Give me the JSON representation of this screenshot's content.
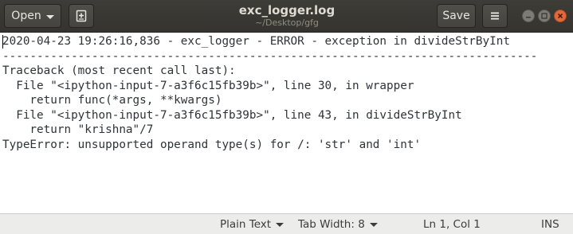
{
  "window": {
    "title": "exc_logger.log",
    "subtitle": "~/Desktop/gfg"
  },
  "toolbar": {
    "open_label": "Open",
    "save_label": "Save"
  },
  "icons": {
    "new_tab": "new-tab-icon",
    "menu": "hamburger-menu-icon",
    "minimize": "minimize-icon",
    "maximize": "maximize-icon",
    "close": "close-icon"
  },
  "colors": {
    "headerbar": "#3d3c37",
    "close_button": "#e5683a",
    "text": "#2e3436",
    "statusbar": "#ececea"
  },
  "editor": {
    "lines": [
      "2020-04-23 19:26:16,836 - exc_logger - ERROR - exception in divideStrByInt",
      "------------------------------------------------------------------------------",
      "Traceback (most recent call last):",
      "  File \"<ipython-input-7-a3f6c15fb39b>\", line 30, in wrapper",
      "    return func(*args, **kwargs)",
      "  File \"<ipython-input-7-a3f6c15fb39b>\", line 43, in divideStrByInt",
      "    return \"krishna\"/7",
      "TypeError: unsupported operand type(s) for /: 'str' and 'int'"
    ]
  },
  "statusbar": {
    "language": "Plain Text",
    "tab_width": "Tab Width: 8",
    "position": "Ln 1, Col 1",
    "mode": "INS"
  }
}
